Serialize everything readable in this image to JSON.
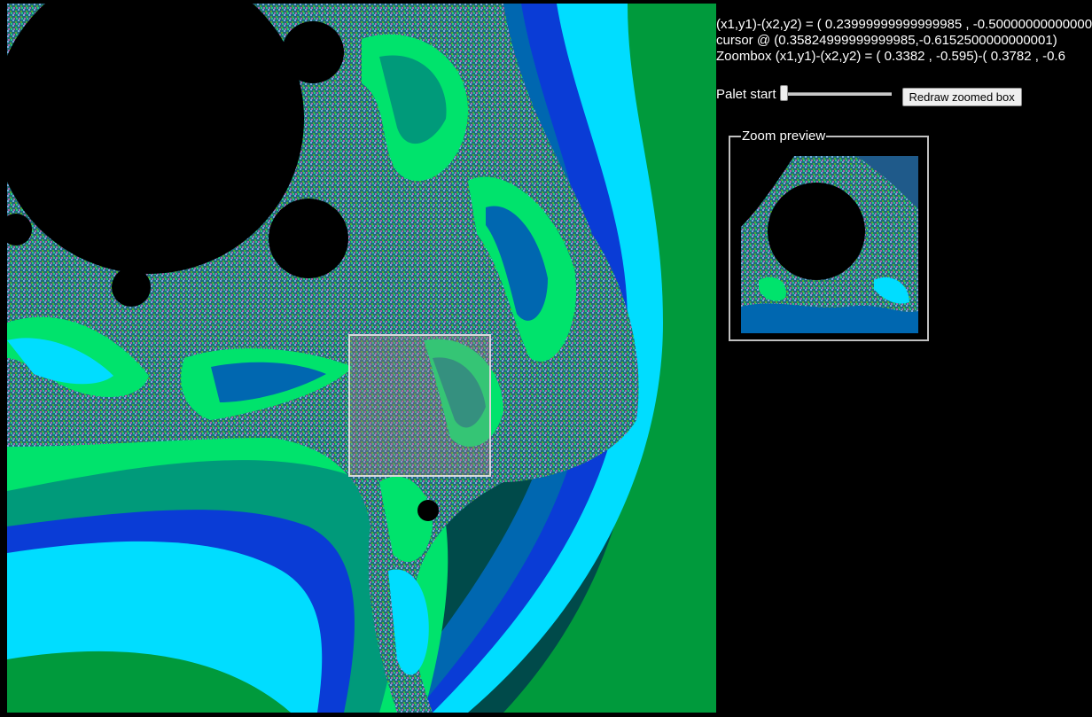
{
  "info": {
    "coords_line": "(x1,y1)-(x2,y2) = ( 0.23999999999999985 ,  -0.50000000000000000",
    "cursor_line": "cursor @ (0.35824999999999985,-0.6152500000000001)",
    "zoombox_line": "Zoombox (x1,y1)-(x2,y2) = ( 0.3382 ,  -0.595)-( 0.3782 ,  -0.6"
  },
  "controls": {
    "palet_label": "Palet start",
    "palet_value": 0,
    "redraw_label": "Redraw zoomed box"
  },
  "preview": {
    "legend": "Zoom preview"
  },
  "palette": [
    "#000000",
    "#00ddff",
    "#0a3cd6",
    "#0067b0",
    "#00e36c",
    "#009a7a",
    "#009a3c",
    "#004a4a",
    "#0c1a70"
  ]
}
